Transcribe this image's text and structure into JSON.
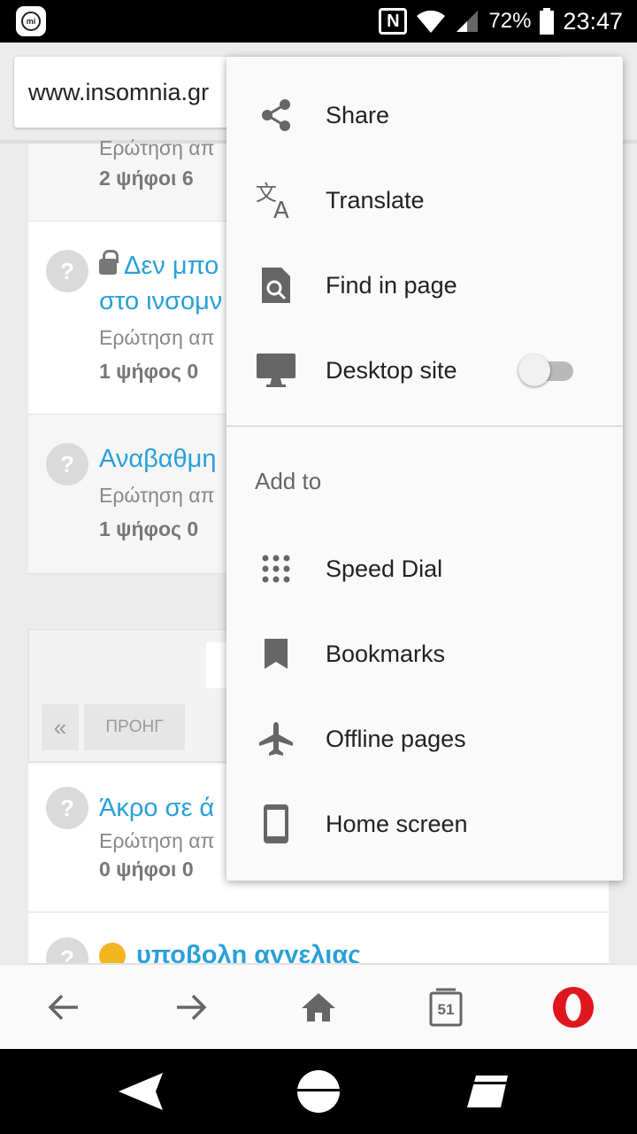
{
  "status": {
    "nfc_label": "N",
    "battery": "72%",
    "time": "23:47"
  },
  "browser": {
    "url": "www.insomnia.gr",
    "tab_count": "51"
  },
  "page": {
    "card1": {
      "sub": "Ερώτηση απ",
      "meta": "2 ψήφοι    6"
    },
    "card2": {
      "title_line1": "Δεν μπο",
      "title_line2": "στο ινσομν",
      "sub": "Ερώτηση απ",
      "meta": "1 ψήφος    0"
    },
    "card3": {
      "title": "Αναβαθμη",
      "sub": "Ερώτηση απ",
      "meta": "1 ψήφος    0"
    },
    "pager": {
      "first": "«",
      "prev": "ΠΡΟΗΓ"
    },
    "card4": {
      "title": "Άκρο σε ά",
      "sub": "Ερώτηση απ",
      "meta": "0 ψήφοι    0"
    },
    "card5": {
      "title": "υποβολη αγγελιας"
    },
    "question_mark": "?"
  },
  "menu": {
    "items": [
      {
        "label": "Share",
        "icon": "share-icon"
      },
      {
        "label": "Translate",
        "icon": "translate-icon"
      },
      {
        "label": "Find in page",
        "icon": "find-in-page-icon"
      },
      {
        "label": "Desktop site",
        "icon": "desktop-icon",
        "toggle": false
      }
    ],
    "section_title": "Add to",
    "add_items": [
      {
        "label": "Speed Dial",
        "icon": "speed-dial-icon"
      },
      {
        "label": "Bookmarks",
        "icon": "bookmark-icon"
      },
      {
        "label": "Offline pages",
        "icon": "airplane-icon"
      },
      {
        "label": "Home screen",
        "icon": "phone-icon"
      }
    ]
  },
  "colors": {
    "link": "#2aa0d8",
    "opera_red": "#e0161f",
    "icon_grey": "#666666"
  }
}
